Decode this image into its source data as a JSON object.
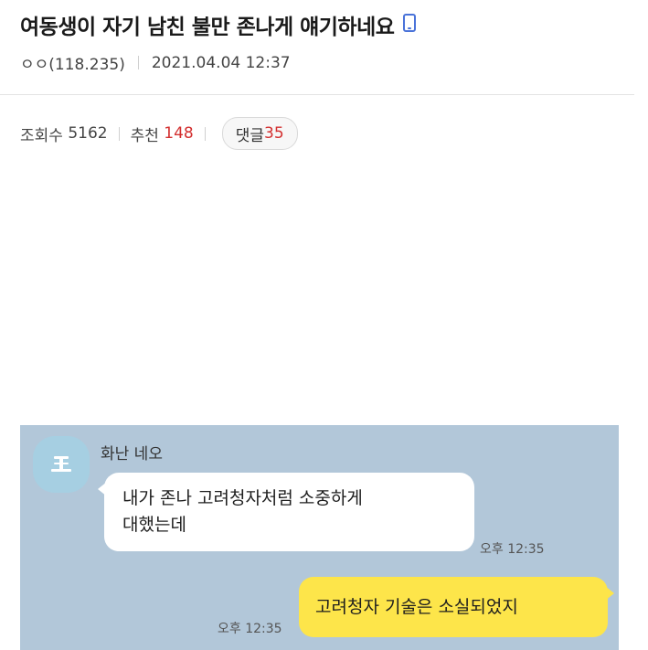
{
  "post": {
    "title": "여동생이 자기 남친 불만 존나게 얘기하네요",
    "device_icon": "mobile-icon",
    "author": "ㅇㅇ(118.235)",
    "date": "2021.04.04 12:37"
  },
  "stats": {
    "views_label": "조회수",
    "views": "5162",
    "recommend_label": "추천",
    "recommend": "148",
    "comments_label": "댓글",
    "comments": "35",
    "accent_color": "#d32f2f"
  },
  "chat": {
    "sender_name": "화난 네오",
    "incoming_line1": "내가 존나 고려청자처럼 소중하게",
    "incoming_line2": "대했는데",
    "incoming_time": "오후 12:35",
    "outgoing_text": "고려청자 기술은 소실되었지",
    "outgoing_time": "오후 12:35",
    "background_color": "#b2c7d9",
    "outgoing_bubble_color": "#fde54a"
  }
}
